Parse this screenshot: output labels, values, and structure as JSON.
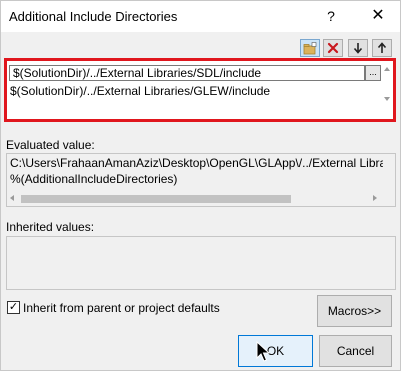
{
  "dialog": {
    "title": "Additional Include Directories",
    "help_glyph": "?",
    "close_glyph": "✕"
  },
  "toolbar": {
    "new_icon": "new-line-folder-icon",
    "delete_icon": "delete-x-icon",
    "down_icon": "move-down-arrow-icon",
    "up_icon": "move-up-arrow-icon"
  },
  "entries": {
    "items": [
      "$(SolutionDir)/../External Libraries/SDL/include",
      "$(SolutionDir)/../External Libraries/GLEW/include"
    ],
    "browse_label": "..."
  },
  "evaluated": {
    "label": "Evaluated value:",
    "lines": [
      "C:\\Users\\FrahaanAmanAziz\\Desktop\\OpenGL\\GLApp\\/../External Libra",
      "%(AdditionalIncludeDirectories)"
    ]
  },
  "inherited": {
    "label": "Inherited values:"
  },
  "inherit_checkbox": {
    "label": "Inherit from parent or project defaults",
    "checked": true,
    "check_glyph": "✓"
  },
  "buttons": {
    "macros": "Macros>>",
    "ok": "OK",
    "cancel": "Cancel"
  },
  "colors": {
    "highlight_border": "#e0161d",
    "ok_border": "#0078d7"
  }
}
